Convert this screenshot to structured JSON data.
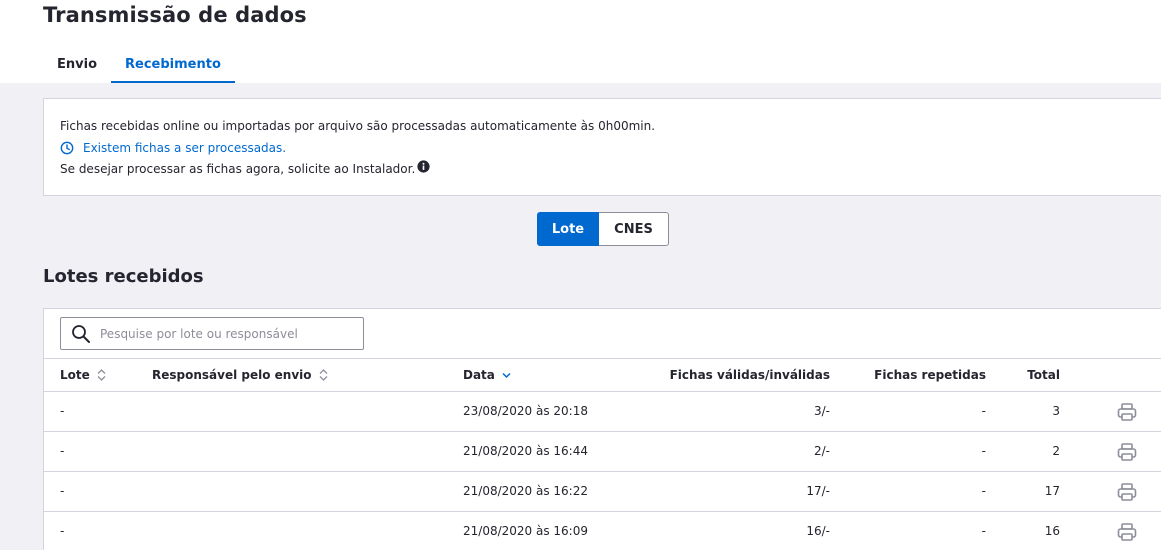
{
  "page": {
    "title": "Transmissão de dados"
  },
  "tabs": [
    {
      "label": "Envio",
      "active": false
    },
    {
      "label": "Recebimento",
      "active": true
    }
  ],
  "info": {
    "line1": "Fichas recebidas online ou importadas por arquivo são processadas automaticamente às 0h00min.",
    "line2": "Existem fichas a ser processadas.",
    "line3": "Se desejar processar as fichas agora, solicite ao Instalador."
  },
  "toggle": {
    "lote_label": "Lote",
    "cnes_label": "CNES",
    "selected": "Lote"
  },
  "section": {
    "title": "Lotes recebidos"
  },
  "search": {
    "value": "",
    "placeholder": "Pesquise por lote ou responsável"
  },
  "table": {
    "headers": {
      "lote": "Lote",
      "responsavel": "Responsável pelo envio",
      "data": "Data",
      "fichas": "Fichas válidas/inválidas",
      "repetidas": "Fichas repetidas",
      "total": "Total"
    },
    "rows": [
      {
        "lote": "-",
        "responsavel": "",
        "data": "23/08/2020 às 20:18",
        "fichas": "3/-",
        "repetidas": "-",
        "total": "3"
      },
      {
        "lote": "-",
        "responsavel": "",
        "data": "21/08/2020 às 16:44",
        "fichas": "2/-",
        "repetidas": "-",
        "total": "2"
      },
      {
        "lote": "-",
        "responsavel": "",
        "data": "21/08/2020 às 16:22",
        "fichas": "17/-",
        "repetidas": "-",
        "total": "17"
      },
      {
        "lote": "-",
        "responsavel": "",
        "data": "21/08/2020 às 16:09",
        "fichas": "16/-",
        "repetidas": "-",
        "total": "16"
      }
    ]
  },
  "colors": {
    "accent": "#0069d0",
    "background": "#f0f0f5",
    "text": "#24252e",
    "border": "#d3d4dd",
    "muted": "#8d8e99"
  },
  "icons": {
    "clock": "clock-icon",
    "info": "info-icon",
    "search": "search-icon",
    "sort": "sort-icon",
    "sort_desc": "sort-down-icon",
    "print": "printer-icon"
  }
}
